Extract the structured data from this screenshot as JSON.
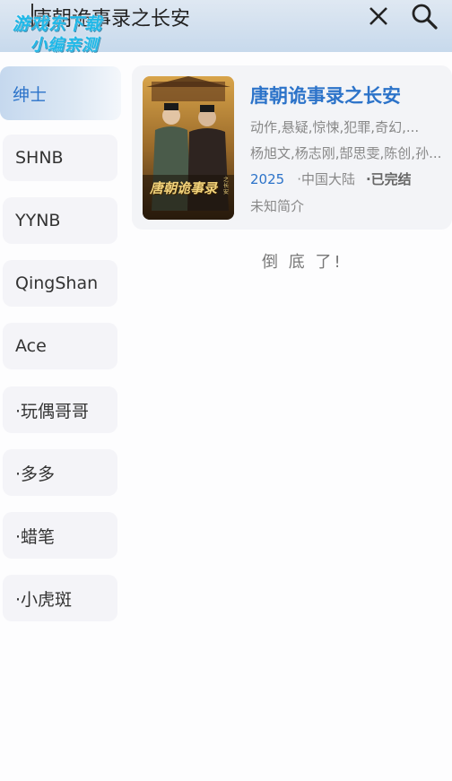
{
  "search": {
    "query": "唐朝诡事录之长安",
    "watermark_line1": "游戏东下载",
    "watermark_line2": "小编亲测"
  },
  "sidebar": {
    "items": [
      {
        "label": "绅士",
        "active": true
      },
      {
        "label": "SHNB"
      },
      {
        "label": "YYNB"
      },
      {
        "label": "QingShan"
      },
      {
        "label": "Ace"
      },
      {
        "label": "·玩偶哥哥"
      },
      {
        "label": "·多多"
      },
      {
        "label": "·蜡笔"
      },
      {
        "label": "·小虎斑"
      }
    ]
  },
  "results": [
    {
      "title": "唐朝诡事录之长安",
      "genres": "动作,悬疑,惊悚,犯罪,奇幻,...",
      "cast": "杨旭文,杨志刚,郜思雯,陈创,孙...",
      "year": "2025",
      "region": "·中国大陆",
      "status": "·已完结",
      "description": "未知简介",
      "poster_text": "唐朝诡事录",
      "poster_subtext": "之长安"
    }
  ],
  "footer": {
    "end_text": "倒 底 了!"
  },
  "colors": {
    "accent": "#2c73c9",
    "topbar": "#d3e1ef",
    "card_bg": "#f3f4f7"
  },
  "icons": {
    "close": "close-icon",
    "search": "search-icon"
  }
}
